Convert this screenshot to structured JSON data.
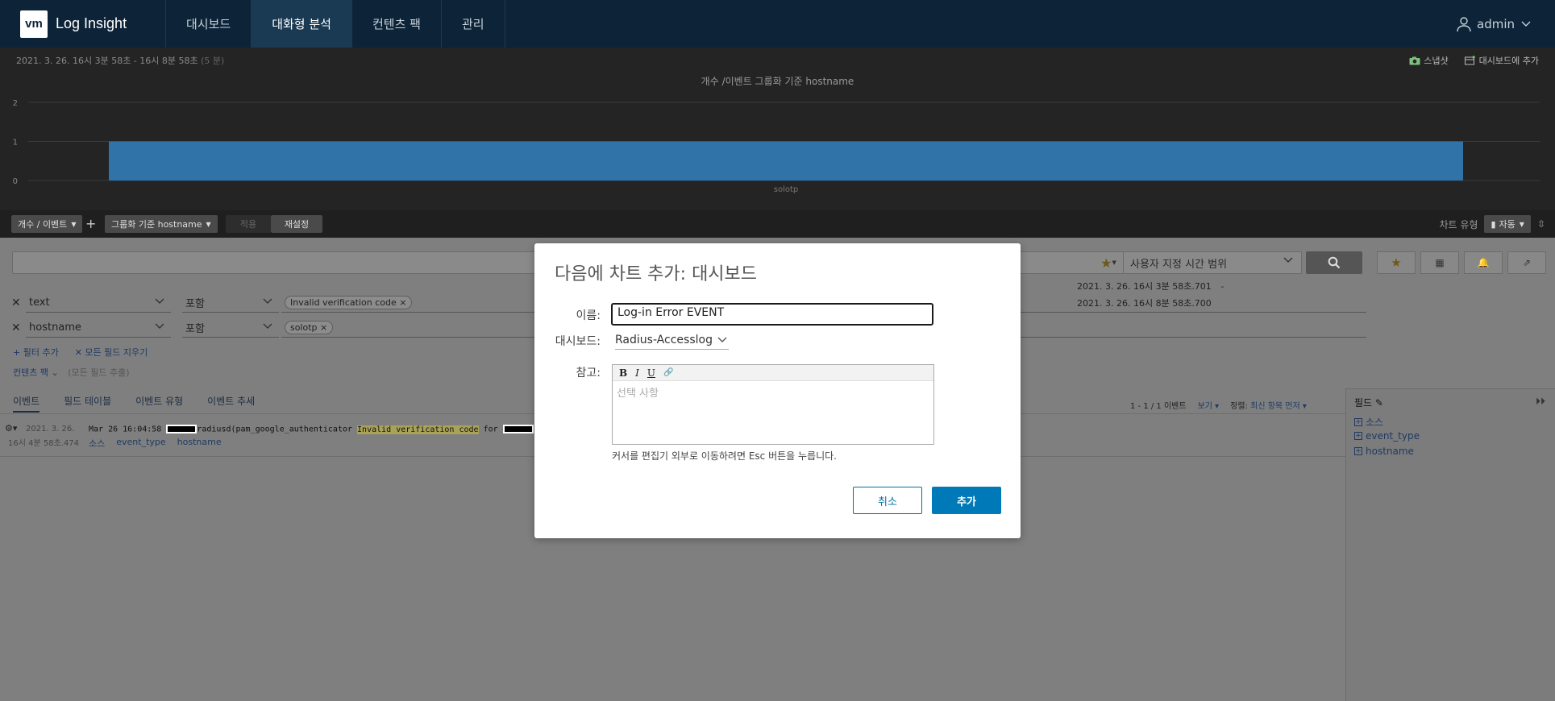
{
  "app": {
    "logo": "vm",
    "title": "Log Insight"
  },
  "nav": [
    {
      "label": "대시보드",
      "active": false
    },
    {
      "label": "대화형 분석",
      "active": true
    },
    {
      "label": "컨텐츠 팩",
      "active": false
    },
    {
      "label": "관리",
      "active": false
    }
  ],
  "user": {
    "name": "admin"
  },
  "chart_header": {
    "date_range": "2021. 3. 26.  16시 3분 58초 - 16시 8분 58초",
    "duration": "(5 분)",
    "snapshot_label": "스냅샷",
    "add_dashboard_label": "대시보드에 추가"
  },
  "chart_data": {
    "type": "bar",
    "title": "개수 /이벤트 그룹화 기준 hostname",
    "categories": [
      "solotp"
    ],
    "values": [
      1
    ],
    "ylim": [
      0,
      2
    ],
    "yticks": [
      0,
      1,
      2
    ],
    "grid": true,
    "bar_color": "#2f73a8"
  },
  "controls": {
    "metric_label": "개수 / 이벤트",
    "group_label": "그룹화 기준 hostname",
    "apply_label": "적용",
    "reset_label": "재설정",
    "chart_type_label": "차트 유형",
    "chart_type_value": "자동"
  },
  "query": {
    "time_range": "사용자 지정 시간 범위",
    "start_time": "2021. 3. 26.  16시 3분 58초.701",
    "start_dash": "-",
    "end_time": "2021. 3. 26.  16시 8분 58초.700"
  },
  "filters": [
    {
      "field": "text",
      "op": "포함",
      "value": "Invalid verification code"
    },
    {
      "field": "hostname",
      "op": "포함",
      "value": "solotp"
    }
  ],
  "filter_links": {
    "add": "+ 필터 추가",
    "clear": "✕ 모든 필드 지우기"
  },
  "content_pack": {
    "label": "컨텐츠 팩",
    "hint": "(모든 필드 추출)"
  },
  "tabs": [
    "이벤트",
    "필드 테이블",
    "이벤트 유형",
    "이벤트 추세"
  ],
  "list_meta": {
    "count": "1 - 1 / 1 이벤트",
    "view": "보기",
    "sort_label": "정렬:",
    "sort_value": "최신 항목 먼저"
  },
  "event": {
    "gear": "⚙▾",
    "date": "2021. 3. 26.",
    "time": "16시 4분 58초.474",
    "text_pre": "Mar 26 16:04:58",
    "text_proc": "radiusd(pam_google_authenticator",
    "text_hl": "Invalid verification code",
    "text_for": "for",
    "fields": [
      "소스",
      "event_type",
      "hostname"
    ]
  },
  "fields_panel": {
    "title": "필드",
    "items": [
      "소스",
      "event_type",
      "hostname"
    ]
  },
  "modal": {
    "title": "다음에 차트 추가: 대시보드",
    "name_label": "이름:",
    "name_value": "Log-in Error EVENT",
    "dashboard_label": "대시보드:",
    "dashboard_value": "Radius-Accesslog",
    "note_label": "참고:",
    "note_placeholder": "선택 사항",
    "toolbar": [
      "B",
      "I",
      "U",
      "🔗"
    ],
    "hint": "커서를 편집기 외부로 이동하려면 Esc 버튼을 누릅니다.",
    "cancel_label": "취소",
    "add_label": "추가"
  }
}
